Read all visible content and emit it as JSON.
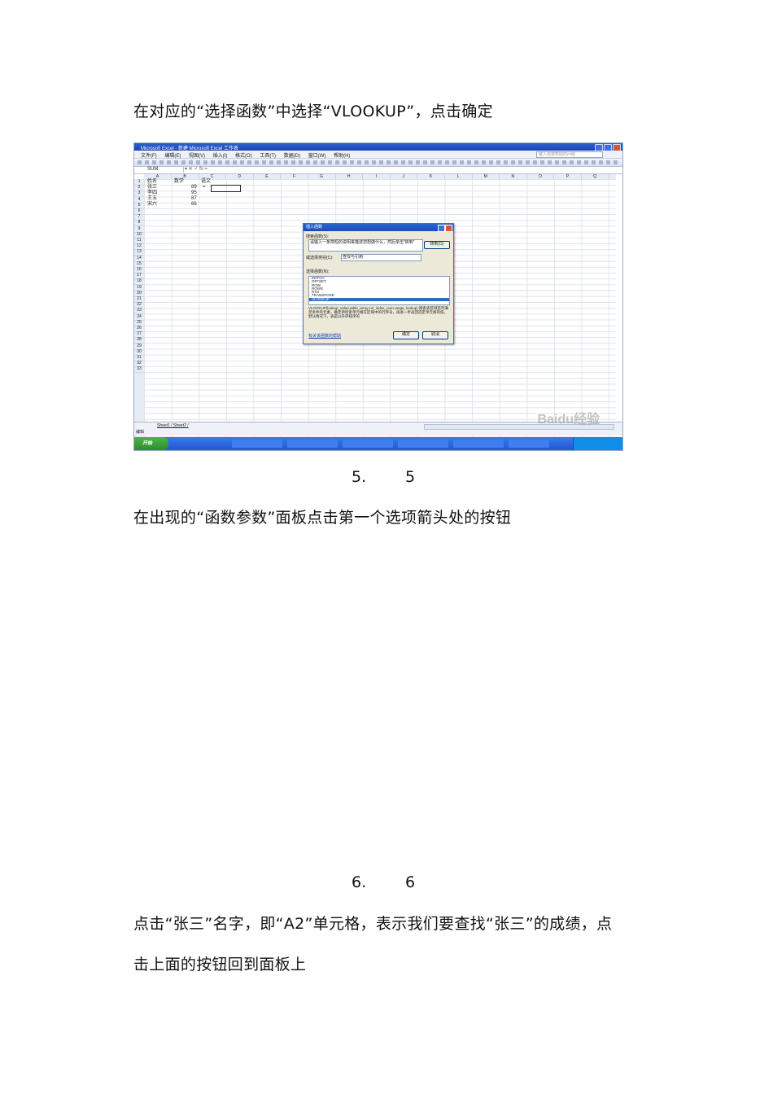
{
  "step4_instruction": "在对应的“选择函数”中选择“VLOOKUP”，点击确定",
  "step5": {
    "number": "5.",
    "label": "5",
    "instruction": "在出现的“函数参数”面板点击第一个选项箭头处的按钮"
  },
  "step6": {
    "number": "6.",
    "label": "6",
    "instruction_line1": "点击“张三”名字，即“A2”单元格，表示我们要查找“张三”的成绩，点",
    "instruction_line2": "击上面的按钮回到面板上"
  },
  "screenshot": {
    "window_title": "Microsoft Excel - 新建 Microsoft Excel 工作表",
    "menu": [
      "文件(F)",
      "编辑(E)",
      "视图(V)",
      "插入(I)",
      "格式(O)",
      "工具(T)",
      "数据(D)",
      "窗口(W)",
      "帮助(H)"
    ],
    "help_placeholder": "键入需要帮助的问题",
    "name_box": "SUM",
    "formula_prefix": "▾ ✕ ✓ fx =",
    "columns": [
      "A",
      "B",
      "C",
      "D",
      "E",
      "F",
      "G",
      "H",
      "I",
      "J",
      "K",
      "L",
      "M",
      "N",
      "O",
      "P",
      "Q"
    ],
    "rows": [
      "1",
      "2",
      "3",
      "4",
      "5",
      "6",
      "7",
      "8",
      "9",
      "10",
      "11",
      "12",
      "13",
      "14",
      "15",
      "16",
      "17",
      "18",
      "19",
      "20",
      "21",
      "22",
      "23",
      "24",
      "25",
      "26",
      "27",
      "28",
      "29",
      "30",
      "31",
      "32",
      "33"
    ],
    "table": [
      [
        "姓名",
        "数学",
        "语文"
      ],
      [
        "张三",
        "89",
        "="
      ],
      [
        "李四",
        "95",
        ""
      ],
      [
        "王五",
        "87",
        ""
      ],
      [
        "宋六",
        "66",
        ""
      ]
    ],
    "dialog": {
      "title": "插入函数",
      "search_label": "搜索函数(S):",
      "search_text": "请输入一条简短的说明来描述您想做什么，然后单击“转到”",
      "go_button": "转到(G)",
      "category_label": "或选择类别(C):",
      "category_value": "查找与引用",
      "select_label": "选择函数(N):",
      "functions": [
        "MATCH",
        "OFFSET",
        "ROW",
        "ROWS",
        "RTD",
        "TRANSPOSE",
        "VLOOKUP"
      ],
      "description": "VLOOKUP(lookup_value,table_array,col_index_num,range_lookup) 搜索表区域首列满足条件的元素，确定待检索单元格在区域中的行序号，再进一步返回选定单元格的值。默认情况下，表是以升序排序的",
      "help_link": "有关该函数的帮助",
      "ok": "确定",
      "cancel": "取消"
    },
    "sheet_tab": "Sheet1 / Sheet2 /",
    "status": "编辑",
    "start_button": "开始",
    "watermark": "Baidu经验"
  }
}
